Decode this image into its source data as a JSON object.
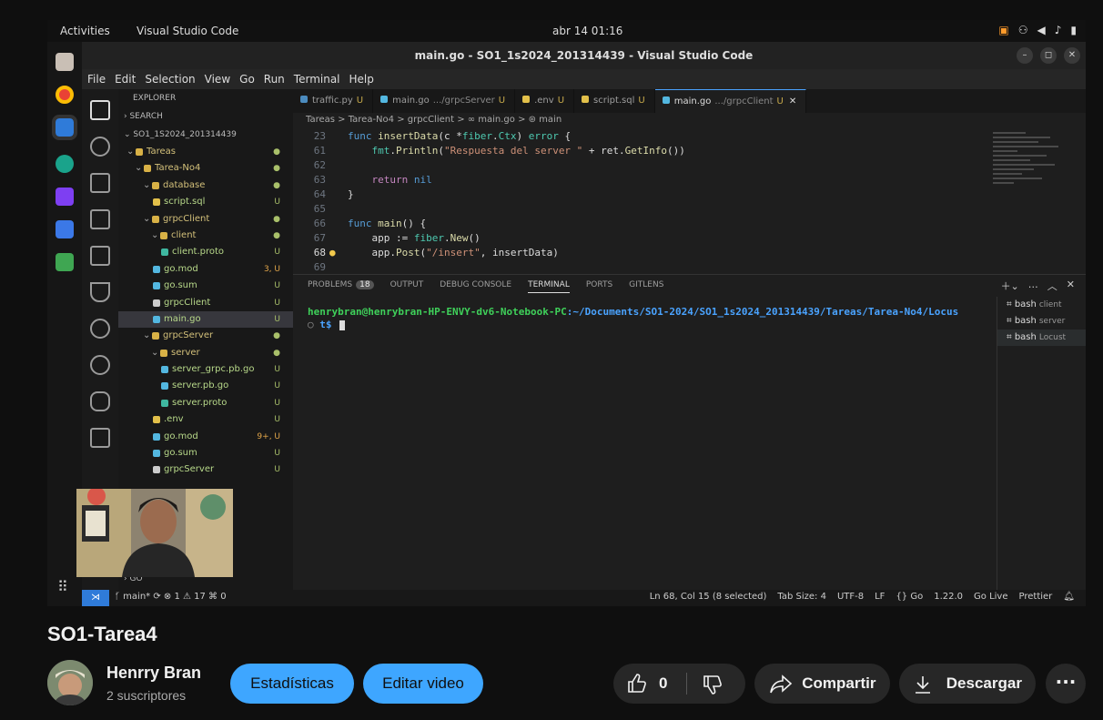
{
  "desktop": {
    "activities": "Activities",
    "app_name": "Visual Studio Code",
    "clock": "abr 14  01:16"
  },
  "vscode": {
    "window_title": "main.go - SO1_1s2024_201314439 - Visual Studio Code",
    "menu": [
      "File",
      "Edit",
      "Selection",
      "View",
      "Go",
      "Run",
      "Terminal",
      "Help"
    ],
    "explorer": {
      "title": "EXPLORER",
      "search_section": "SEARCH",
      "project": "SO1_1S2024_201314439",
      "outline_section": "GO",
      "tree": [
        {
          "label": "Tareas",
          "badge": "●",
          "kind": "folder"
        },
        {
          "label": "Tarea-No4",
          "badge": "●",
          "kind": "folder"
        },
        {
          "label": "database",
          "badge": "●",
          "kind": "folder"
        },
        {
          "label": "script.sql",
          "badge": "U",
          "kind": "sql"
        },
        {
          "label": "grpcClient",
          "badge": "●",
          "kind": "folder"
        },
        {
          "label": "client",
          "badge": "●",
          "kind": "folder"
        },
        {
          "label": "client.proto",
          "badge": "U",
          "kind": "proto"
        },
        {
          "label": "go.mod",
          "badge": "3, U",
          "kind": "go"
        },
        {
          "label": "go.sum",
          "badge": "U",
          "kind": "go"
        },
        {
          "label": "grpcClient",
          "badge": "U",
          "kind": "file"
        },
        {
          "label": "main.go",
          "badge": "U",
          "kind": "go"
        },
        {
          "label": "grpcServer",
          "badge": "●",
          "kind": "folder"
        },
        {
          "label": "server",
          "badge": "●",
          "kind": "folder"
        },
        {
          "label": "server_grpc.pb.go",
          "badge": "U",
          "kind": "go"
        },
        {
          "label": "server.pb.go",
          "badge": "U",
          "kind": "go"
        },
        {
          "label": "server.proto",
          "badge": "U",
          "kind": "proto"
        },
        {
          "label": ".env",
          "badge": "U",
          "kind": "env"
        },
        {
          "label": "go.mod",
          "badge": "9+, U",
          "kind": "go"
        },
        {
          "label": "go.sum",
          "badge": "U",
          "kind": "go"
        },
        {
          "label": "grpcServer",
          "badge": "U",
          "kind": "file"
        }
      ]
    },
    "tabs": [
      {
        "icon": "python-icon",
        "name": "traffic.py",
        "hint": "",
        "status": "U"
      },
      {
        "icon": "go-icon",
        "name": "main.go",
        "hint": ".../grpcServer",
        "status": "U"
      },
      {
        "icon": "env-icon",
        "name": ".env",
        "hint": "",
        "status": "U"
      },
      {
        "icon": "database-icon",
        "name": "script.sql",
        "hint": "",
        "status": "U"
      },
      {
        "icon": "go-icon",
        "name": "main.go",
        "hint": ".../grpcClient",
        "status": "U"
      }
    ],
    "breadcrumb": "Tareas > Tarea-No4 > grpcClient > ∞ main.go > ⊛ main",
    "code_lines": [
      {
        "num": "23",
        "html": "<span class='kw'>func</span> <span class='fn'>insertData</span>(c *<span class='typ'>fiber</span>.<span class='typ'>Ctx</span>) <span class='typ'>error</span> {"
      },
      {
        "num": "61",
        "html": "    <span class='typ'>fmt</span>.<span class='fn'>Println</span>(<span class='str'>\"Respuesta del server \"</span> + ret.<span class='fn'>GetInfo</span>())"
      },
      {
        "num": "62",
        "html": ""
      },
      {
        "num": "63",
        "html": "    <span class='kw2'>return</span> <span class='kw'>nil</span>"
      },
      {
        "num": "64",
        "html": "}"
      },
      {
        "num": "65",
        "html": ""
      },
      {
        "num": "66",
        "html": "<span class='kw'>func</span> <span class='fn'>main</span>() {"
      },
      {
        "num": "67",
        "html": "    app := <span class='typ'>fiber</span>.<span class='fn'>New</span>()"
      },
      {
        "num": "68",
        "html": "    app.<span class='fn'>Post</span>(<span class='str'>\"/insert\"</span>, insertData)"
      },
      {
        "num": "69",
        "html": ""
      }
    ],
    "panel_tabs": [
      {
        "label": "PROBLEMS",
        "count": "18"
      },
      {
        "label": "OUTPUT",
        "count": ""
      },
      {
        "label": "DEBUG CONSOLE",
        "count": ""
      },
      {
        "label": "TERMINAL",
        "count": ""
      },
      {
        "label": "PORTS",
        "count": ""
      },
      {
        "label": "GITLENS",
        "count": ""
      }
    ],
    "terminal": {
      "prompt": "henrybran@henrybran-HP-ENVY-dv6-Notebook-PC",
      "path": ":~/Documents/SO1-2024/SO1_1s2024_201314439/Tareas/Tarea-No4/Locus",
      "tail": "t$ "
    },
    "terminals": [
      {
        "name": "bash",
        "hint": "client"
      },
      {
        "name": "bash",
        "hint": "server"
      },
      {
        "name": "bash",
        "hint": "Locust"
      }
    ],
    "status_left": "ᚶ main*  ⟳  ⊗ 1 ⚠ 17   ⌘ 0",
    "status_right": [
      "Ln 68, Col 15 (8 selected)",
      "Tab Size: 4",
      "UTF-8",
      "LF",
      "{} Go",
      "1.22.0",
      "Go Live",
      "Prettier"
    ]
  },
  "video": {
    "title": "SO1-Tarea4",
    "channel": "Henrry Bran",
    "subscribers": "2 suscriptores",
    "stats_button": "Estadísticas",
    "edit_button": "Editar video",
    "likes": "0",
    "share_button": "Compartir",
    "download_button": "Descargar"
  },
  "colors": {
    "accent": "#3ea6ff",
    "pill_bg": "#272727",
    "terminal_prompt": "#3fd15a",
    "terminal_path": "#4aa3ff",
    "vscode_blue": "#2f7bd9"
  }
}
